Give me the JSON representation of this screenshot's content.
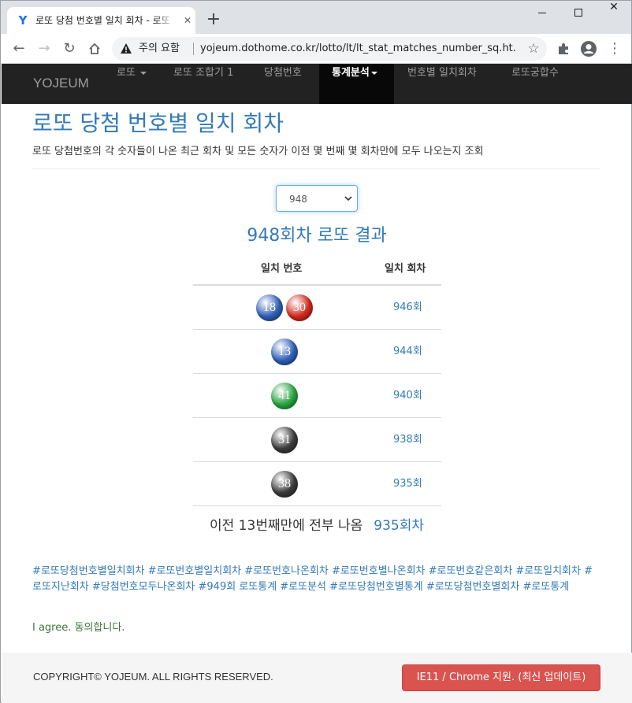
{
  "browser": {
    "tab_title": "로또 당첨 번호별 일치 회차 - 로또",
    "tab_close": "✕",
    "new_tab": "+",
    "security_label": "주의 요함",
    "url": "yojeum.dothome.co.kr/lotto/lt/lt_stat_matches_number_sq.ht..."
  },
  "navbar": {
    "brand": "YOJEUM",
    "items": [
      {
        "label": "로또",
        "dropdown": true
      },
      {
        "label": "로또 조합기 1",
        "dropdown": false
      },
      {
        "label": "당첨번호",
        "dropdown": false
      },
      {
        "label": "통계분석",
        "dropdown": true,
        "active": true
      },
      {
        "label": "번호별 일치회차",
        "dropdown": false
      },
      {
        "label": "로또궁합수",
        "dropdown": false
      }
    ]
  },
  "page": {
    "title": "로또 당첨 번호별 일치 회차",
    "description": "로또 당첨번호의 각 숫자들이 나온 최근 회차 및 모든 숫자가 이전 몇 번째 몇 회차만에 모두 나오는지 조회",
    "selected_round": "948",
    "result_title": "948회차 로또 결과"
  },
  "table": {
    "headers": {
      "numbers": "일치 번호",
      "round": "일치 회차"
    },
    "rows": [
      {
        "balls": [
          {
            "n": "18",
            "color": "#2f5fb7"
          },
          {
            "n": "30",
            "color": "#d2281c"
          }
        ],
        "round": "946회"
      },
      {
        "balls": [
          {
            "n": "13",
            "color": "#2f5fb7"
          }
        ],
        "round": "944회"
      },
      {
        "balls": [
          {
            "n": "41",
            "color": "#27a43f"
          }
        ],
        "round": "940회"
      },
      {
        "balls": [
          {
            "n": "31",
            "color": "#3b3b3b"
          }
        ],
        "round": "938회"
      },
      {
        "balls": [
          {
            "n": "38",
            "color": "#3b3b3b"
          }
        ],
        "round": "935회"
      }
    ]
  },
  "summary": {
    "text": "이전 13번째만에 전부 나옴",
    "round": "935회차"
  },
  "hashtags": "#로또당첨번호별일치회차 #로또번호별일치회차 #로또번호나온회차 #로또번호별나온회차 #로또번호같은회차 #로또일치회차 #로또지난회차 #당첨번호모두나온회차 #949회 로또통계 #로또분석 #로또당첨번호별통계 #로또당첨번호별회차 #로또통계",
  "agree": "I agree. 동의합니다.",
  "footer": {
    "copyright": "COPYRIGHT© YOJEUM. ALL RIGHTS RESERVED.",
    "update_button": "IE11 / Chrome 지원. (최신 업데이트)"
  },
  "colors": {
    "link": "#337ab7",
    "navbar_bg": "#222222",
    "agree": "#3c763d",
    "button": "#d9534f"
  }
}
